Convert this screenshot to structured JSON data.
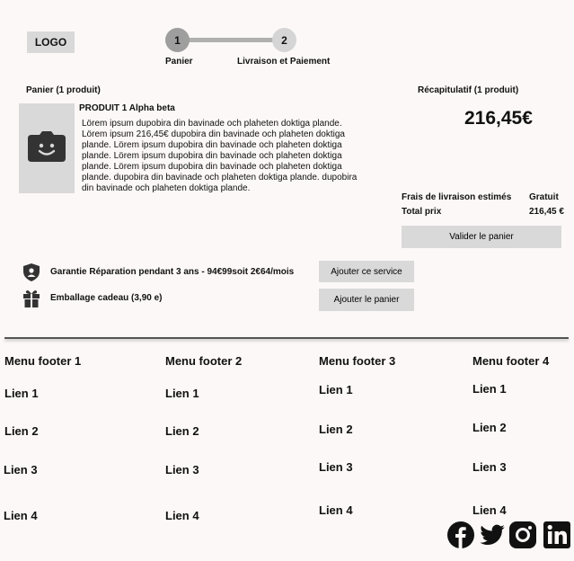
{
  "header": {
    "logo": "LOGO",
    "steps": [
      {
        "number": "1",
        "label": "Panier"
      },
      {
        "number": "2",
        "label": "Livraison et Paiement"
      }
    ]
  },
  "cart": {
    "title": "Panier (1 produit)",
    "product": {
      "name": "PRODUIT 1 Alpha beta",
      "description": "Lörem ipsum dupobira din bavinade och plaheten doktiga plande. Lörem ipsum 216,45€ dupobira din bavinade och plaheten doktiga plande. Lörem ipsum dupobira din bavinade och plaheten doktiga plande. Lörem ipsum dupobira din bavinade och plaheten doktiga plande. Lörem ipsum dupobira din bavinade och plaheten doktiga plande. dupobira din bavinade och plaheten doktiga plande. dupobira din bavinade och plaheten doktiga plande.",
      "image_icon": "camera-smile-icon"
    }
  },
  "summary": {
    "title": "Récapitulatif (1 produit)",
    "price": "216,45€",
    "shipping_label": "Frais de livraison estimés",
    "shipping_value": "Gratuit",
    "total_label": "Total prix",
    "total_value": "216,45 €",
    "validate_label": "Valider le panier"
  },
  "options": [
    {
      "icon": "shield-user-icon",
      "label": "Garantie Réparation pendant 3 ans - 94€99soit 2€64/mois",
      "button": "Ajouter ce service"
    },
    {
      "icon": "gift-icon",
      "label": "Emballage cadeau (3,90 e)",
      "button": "Ajouter le panier"
    }
  ],
  "footer": {
    "columns": [
      {
        "title": "Menu footer 1",
        "links": [
          "Lien 1",
          "Lien 2",
          "Lien 3",
          "Lien 4"
        ]
      },
      {
        "title": "Menu footer 2",
        "links": [
          "Lien 1",
          "Lien 2",
          "Lien 3",
          "Lien 4"
        ]
      },
      {
        "title": "Menu footer 3",
        "links": [
          "Lien 1",
          "Lien 2",
          "Lien 3",
          "Lien 4"
        ]
      },
      {
        "title": "Menu footer 4",
        "links": [
          "Lien 1",
          "Lien 2",
          "Lien 3",
          "Lien 4"
        ]
      }
    ],
    "social": [
      "facebook-icon",
      "twitter-icon",
      "instagram-icon",
      "linkedin-icon"
    ]
  }
}
